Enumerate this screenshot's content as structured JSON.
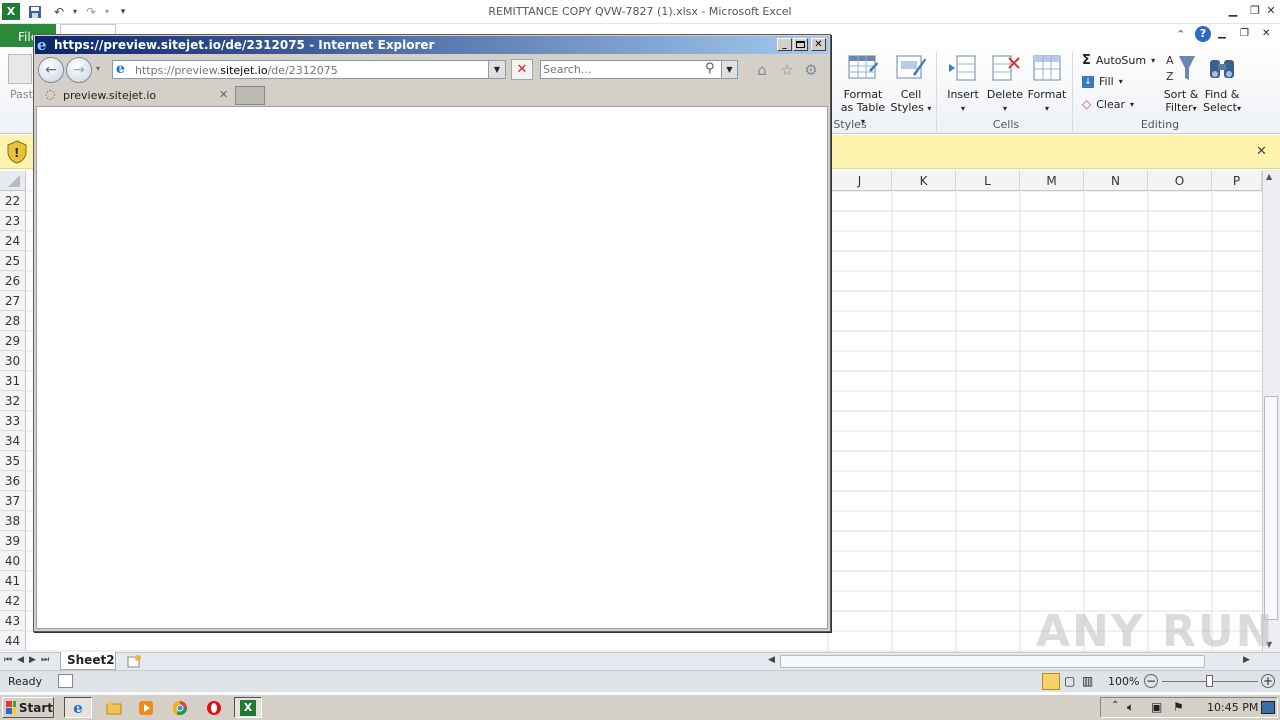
{
  "excel": {
    "title": "REMITTANCE COPY QVW-7827 (1).xlsx - Microsoft Excel",
    "file_tab": "File",
    "paste_label": "Paste",
    "ribbon": {
      "format_as_table": [
        "Format",
        "as Table"
      ],
      "cell_styles": [
        "Cell",
        "Styles"
      ],
      "insert": "Insert",
      "delete": "Delete",
      "format": "Format",
      "autosum": "AutoSum",
      "fill": "Fill",
      "clear": "Clear",
      "sort_filter": [
        "Sort &",
        "Filter"
      ],
      "find_select": [
        "Find &",
        "Select"
      ],
      "groups": {
        "styles": "Styles",
        "cells": "Cells",
        "editing": "Editing"
      }
    },
    "columns": [
      "J",
      "K",
      "L",
      "M",
      "N",
      "O",
      "P"
    ],
    "rows": [
      "22",
      "23",
      "24",
      "25",
      "26",
      "27",
      "28",
      "29",
      "30",
      "31",
      "32",
      "33",
      "34",
      "35",
      "36",
      "37",
      "38",
      "39",
      "40",
      "41",
      "42",
      "43",
      "44"
    ],
    "sheet_tab": "Sheet2",
    "status": "Ready",
    "zoom": "100%"
  },
  "ie": {
    "title": "https://preview.sitejet.io/de/2312075 - Internet Explorer",
    "address_prefix": "https://preview.",
    "address_domain": "sitejet.io",
    "address_suffix": "/de/2312075",
    "search_placeholder": "Search...",
    "tab_label": "preview.sitejet.io"
  },
  "taskbar": {
    "start": "Start",
    "clock": "10:45 PM"
  },
  "watermark": "ANY RUN",
  "colors": {
    "excel_green": "#2a8a3a",
    "ie_title_start": "#0a246a",
    "ie_title_end": "#a6caf0",
    "security_bar": "#fdf4b0"
  }
}
